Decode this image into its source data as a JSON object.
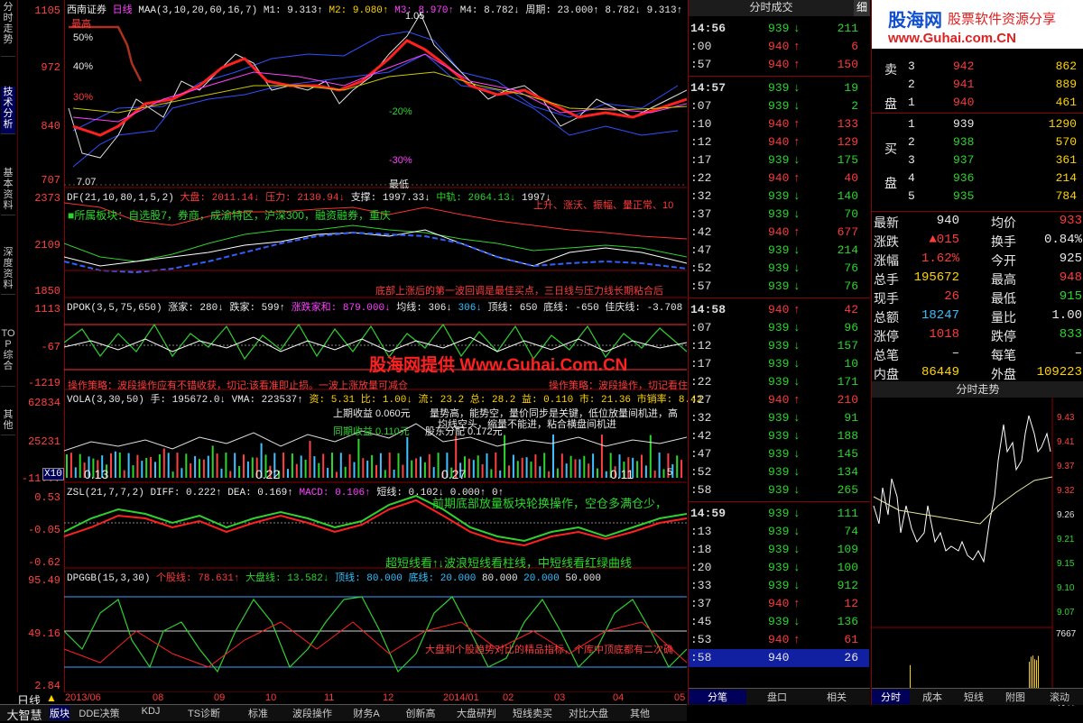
{
  "left_tabs": [
    "分时走势",
    "技术分析",
    "基本资料",
    "深度资料",
    "TOP综合",
    "其他"
  ],
  "axis": {
    "price": [
      "1105",
      "972",
      "840",
      "707"
    ],
    "dmi": [
      "2373",
      "2109",
      "1850"
    ],
    "dpok": [
      "1113",
      "-67",
      "-1219"
    ],
    "vola": [
      "62834",
      "25231",
      "-11..."
    ],
    "zsl": [
      "0.53",
      "-0.05",
      "-0.62"
    ],
    "dpggb": [
      "95.49",
      "49.16",
      "2.84"
    ],
    "x10": "X10"
  },
  "main": {
    "stock": "西南证券",
    "period": "日线",
    "maa": "MAA(3,10,20,60,16,7)",
    "m1": "M1: 9.313↑",
    "m2": "M2: 9.080↑",
    "m3": "M3: 8.970↑",
    "m4": "M4: 8.782↓",
    "zhouqi": "周期: 23.000↑",
    "ma": "8.782↓ 9.313↑",
    "pct": [
      "50%",
      "40%",
      "30%",
      "-20%",
      "-30%"
    ],
    "highest": "最高",
    "lowest": "最低",
    "low_price": "7.07",
    "price_tag": "1.05"
  },
  "dmi": {
    "label": "DF(21,10,80,1,5,2)",
    "dapan": "大盘: 2011.14↓",
    "yali": "压力: 2130.94↓",
    "zhicheng": "支撑: 1997.33↓",
    "zhongjian": "中轨: 2064.13↓",
    "ext": "1997↓",
    "sectors": "■所属板块：自选股7，券商，成渝特区，沪深300，融资融券，重庆",
    "right_note": "上升、涨沃、振幅、量正常、10",
    "bottom_note": "底部上涨后的第一波回调是最佳买点，三日线与压力线长期粘合后"
  },
  "dpok": {
    "label": "DPOK(3,5,75,650)",
    "zhangjia": "涨家: 280↓",
    "diejia": "跌家: 599↑",
    "jiaquan": "涨跌家和: 879.000↓",
    "junxian": "均线: 306↓",
    "v306": "306↓",
    "dingxian": "顶线: 650",
    "dixian": "底线: -650",
    "jiayuan": "佳庆线: -3.708",
    "watermark": "股海网提供 Www.Guhai.Com.CN",
    "left_note": "操作策略：波段操作应有不错收获，切记:该看准即止损。一波上涨放量可减仓",
    "right_note": "操作策略：波段操作，切记看住"
  },
  "vola": {
    "label": "VOLA(3,30,50)",
    "shou": "手: 195672.0↓",
    "vma": "VMA: 223537↑",
    "zi": "资: 5.31",
    "bi": "比: 1.00↓",
    "liu": "流: 23.2",
    "zong": "总: 28.2",
    "yi": "益: 0.110",
    "shi": "市: 21.36",
    "shixiao": "市销率: 8.42",
    "shangqi": "上期收益 0.060元",
    "tongqi": "同期收益 0.110元",
    "fenpei": "股东分配 0.172元",
    "tip1": "量势高，能势空，量价同步是关键，低位放量间机进，高",
    "tip2": "均线空头，缩量不能进，粘合横盘间机进",
    "marks": [
      "0.13",
      "0.22",
      "0.27",
      "0.11"
    ],
    "num": "5"
  },
  "zsl": {
    "label": "ZSL(21,7,7,2)",
    "diff": "DIFF: 0.222↑",
    "dea": "DEA: 0.169↑",
    "macd": "MACD: 0.106↑",
    "duanxian": "短线: 0.102↓",
    "v0": "0.000↑",
    "v0b": "0↑",
    "note1": "前期底部放量板块轮换操作，空仓多满仓少，",
    "note2": "超短线看↑↓波浪短线看柱线，中短线看红绿曲线"
  },
  "dpggb": {
    "label": "DPGGB(15,3,30)",
    "gegu": "个股线: 78.631↑",
    "dapan": "大盘线: 13.582↓",
    "dingxian": "顶线: 80.000",
    "dixian": "底线: 20.000",
    "v80": "80.000",
    "v20": "20.000",
    "v50": "50.000",
    "note": "大盘和个股趋势对比的精品指标，个库中顶底都有二次确"
  },
  "timeline": {
    "label": "日线",
    "dates": [
      "2013/06",
      "08",
      "09",
      "10",
      "11",
      "12",
      "2014/01",
      "02",
      "03",
      "04",
      "05"
    ]
  },
  "bottom_tabs": [
    "大智慧",
    "版块",
    "DDE决策",
    "KDJ",
    "TS诊断",
    "标准",
    "波段操作",
    "财务A",
    "创新高",
    "大盘研判",
    "短线卖买",
    "对比大盘",
    "其他"
  ],
  "ticks": {
    "title": "分时成交",
    "detail": "细",
    "rows": [
      [
        "14:56",
        "939",
        "↓",
        "211",
        "fall"
      ],
      [
        ":00",
        "940",
        "↑",
        "6",
        "rise"
      ],
      [
        ":57",
        "940",
        "↑",
        "150",
        "rise"
      ],
      [
        "14:57",
        "939",
        "↓",
        "19",
        "fall"
      ],
      [
        ":07",
        "939",
        "↓",
        "2",
        "fall"
      ],
      [
        ":10",
        "940",
        "↑",
        "133",
        "rise"
      ],
      [
        ":12",
        "940",
        "↑",
        "129",
        "rise"
      ],
      [
        ":17",
        "939",
        "↓",
        "175",
        "fall"
      ],
      [
        ":22",
        "940",
        "↑",
        "40",
        "rise"
      ],
      [
        ":32",
        "939",
        "↓",
        "140",
        "fall"
      ],
      [
        ":37",
        "939",
        "↓",
        "70",
        "fall"
      ],
      [
        ":42",
        "940",
        "↑",
        "677",
        "rise"
      ],
      [
        ":47",
        "939",
        "↓",
        "214",
        "fall"
      ],
      [
        ":52",
        "939",
        "↓",
        "76",
        "fall"
      ],
      [
        ":57",
        "939",
        "↓",
        "76",
        "fall"
      ],
      [
        "14:58",
        "940",
        "↑",
        "42",
        "rise"
      ],
      [
        ":07",
        "939",
        "↓",
        "96",
        "fall"
      ],
      [
        ":12",
        "939",
        "↓",
        "157",
        "fall"
      ],
      [
        ":17",
        "939",
        "↓",
        "10",
        "fall"
      ],
      [
        ":22",
        "939",
        "↓",
        "171",
        "fall"
      ],
      [
        ":27",
        "940",
        "↑",
        "210",
        "rise"
      ],
      [
        ":32",
        "939",
        "↓",
        "91",
        "fall"
      ],
      [
        ":42",
        "939",
        "↓",
        "188",
        "fall"
      ],
      [
        ":47",
        "939",
        "↓",
        "145",
        "fall"
      ],
      [
        ":52",
        "939",
        "↓",
        "134",
        "fall"
      ],
      [
        ":58",
        "939",
        "↓",
        "265",
        "fall"
      ],
      [
        "14:59",
        "939",
        "↓",
        "111",
        "fall"
      ],
      [
        ":13",
        "939",
        "↓",
        "74",
        "fall"
      ],
      [
        ":18",
        "939",
        "↓",
        "109",
        "fall"
      ],
      [
        ":20",
        "939",
        "↓",
        "100",
        "fall"
      ],
      [
        ":33",
        "939",
        "↓",
        "912",
        "fall"
      ],
      [
        ":37",
        "940",
        "↑",
        "12",
        "rise"
      ],
      [
        ":45",
        "939",
        "↓",
        "136",
        "fall"
      ],
      [
        ":53",
        "940",
        "↑",
        "61",
        "rise"
      ],
      [
        ":58",
        "940",
        "",
        "26",
        "white"
      ]
    ],
    "tabs": [
      "分笔",
      "盘口",
      "相关"
    ]
  },
  "logo": {
    "main": "股海网",
    "slogan": "股票软件资源分享",
    "url": "www.Guhai.com.CN"
  },
  "orderbook": {
    "sell_label": "卖盘",
    "buy_label": "买盘",
    "sell": [
      [
        "3",
        "942",
        "862"
      ],
      [
        "2",
        "941",
        "889"
      ],
      [
        "1",
        "940",
        "461"
      ]
    ],
    "buy": [
      [
        "1",
        "939",
        "1290"
      ],
      [
        "2",
        "938",
        "570"
      ],
      [
        "3",
        "937",
        "361"
      ],
      [
        "4",
        "936",
        "214"
      ],
      [
        "5",
        "935",
        "784"
      ]
    ]
  },
  "stats": [
    [
      "最新",
      "940",
      "均价",
      "933"
    ],
    [
      "涨跌",
      "▲015",
      "换手",
      "0.84%"
    ],
    [
      "涨幅",
      "1.62%",
      "今开",
      "925"
    ],
    [
      "总手",
      "195672",
      "最高",
      "948"
    ],
    [
      "现手",
      "26",
      "最低",
      "915"
    ],
    [
      "总额",
      "18247",
      "量比",
      "1.00"
    ],
    [
      "涨停",
      "1018",
      "跌停",
      "833"
    ],
    [
      "总笔",
      "–",
      "每笔",
      "–"
    ],
    [
      "内盘",
      "86449",
      "外盘",
      "109223"
    ]
  ],
  "mini": {
    "title": "分时走势",
    "scale": [
      "9.43",
      "9.41",
      "9.37",
      "9.32",
      "9.26",
      "9.21",
      "9.15",
      "9.10",
      "9.07"
    ],
    "vol_top": "7667",
    "vol_unit": "分钟",
    "tabs": [
      "分时",
      "成本",
      "短线",
      "附图",
      "滚动"
    ]
  }
}
